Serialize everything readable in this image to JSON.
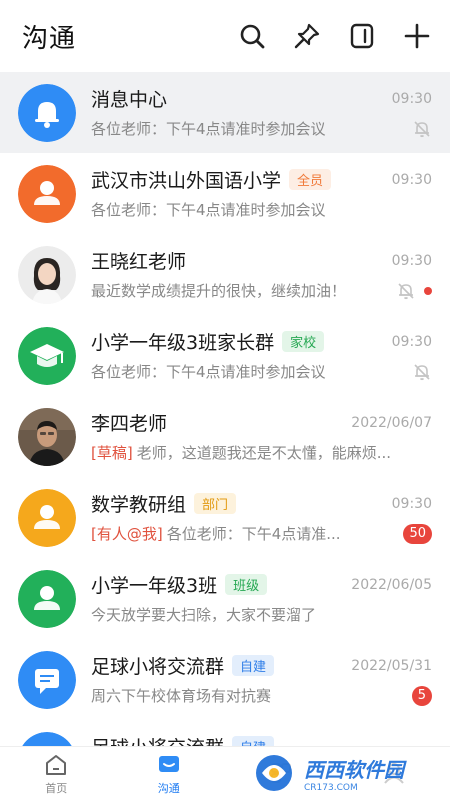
{
  "header": {
    "title": "沟通",
    "icons": [
      "search-icon",
      "pin-icon",
      "notebook-icon",
      "plus-icon"
    ]
  },
  "conversations": [
    {
      "name": "消息中心",
      "tag": "",
      "time": "09:30",
      "prefix": "",
      "preview": "各位老师：下午4点请准时参加会议",
      "muted": true,
      "dot": false,
      "badge": "",
      "avatar": "bell-icon",
      "avatar_color": "#2f8cf5"
    },
    {
      "name": "武汉市洪山外国语小学",
      "tag": "全员",
      "tag_color": "#f07a3a",
      "tag_bg": "#fdeee4",
      "time": "09:30",
      "prefix": "",
      "preview": "各位老师：下午4点请准时参加会议",
      "muted": false,
      "dot": false,
      "badge": "",
      "avatar": "group-icon",
      "avatar_color": "#f26b2c"
    },
    {
      "name": "王晓红老师",
      "tag": "",
      "time": "09:30",
      "prefix": "",
      "preview": "最近数学成绩提升的很快，继续加油！",
      "muted": true,
      "dot": true,
      "badge": "",
      "avatar": "photo-woman",
      "avatar_color": "#eeeeee"
    },
    {
      "name": "小学一年级3班家长群",
      "tag": "家校",
      "tag_color": "#27a853",
      "tag_bg": "#e3f5e8",
      "time": "09:30",
      "prefix": "",
      "preview": "各位老师：下午4点请准时参加会议",
      "muted": true,
      "dot": false,
      "badge": "",
      "avatar": "graduation-cap-icon",
      "avatar_color": "#22b05a"
    },
    {
      "name": "李四老师",
      "tag": "",
      "time": "2022/06/07",
      "prefix": "[草稿]",
      "preview": "老师，这道题我还是不太懂，能麻烦...",
      "muted": false,
      "dot": false,
      "badge": "",
      "avatar": "photo-man",
      "avatar_color": "#5a4a3a"
    },
    {
      "name": "数学教研组",
      "tag": "部门",
      "tag_color": "#e29a10",
      "tag_bg": "#fdf2dc",
      "time": "09:30",
      "prefix": "[有人@我]",
      "preview": "各位老师：下午4点请准...",
      "muted": false,
      "dot": false,
      "badge": "50",
      "avatar": "person-icon",
      "avatar_color": "#f5a81c"
    },
    {
      "name": "小学一年级3班",
      "tag": "班级",
      "tag_color": "#27a853",
      "tag_bg": "#e3f5e8",
      "time": "2022/06/05",
      "prefix": "",
      "preview": "今天放学要大扫除，大家不要溜了",
      "muted": false,
      "dot": false,
      "badge": "",
      "avatar": "person-icon",
      "avatar_color": "#22b05a"
    },
    {
      "name": "足球小将交流群",
      "tag": "自建",
      "tag_color": "#2f7ee8",
      "tag_bg": "#e3eefc",
      "time": "2022/05/31",
      "prefix": "",
      "preview": "周六下午校体育场有对抗赛",
      "muted": false,
      "dot": false,
      "badge": "5",
      "avatar": "chat-icon",
      "avatar_color": "#2f8cf5"
    },
    {
      "name": "足球小将交流群",
      "tag": "自建",
      "tag_color": "#2f7ee8",
      "tag_bg": "#e3eefc",
      "time": "",
      "prefix": "",
      "preview": "",
      "muted": false,
      "dot": false,
      "badge": "",
      "avatar": "chat-icon",
      "avatar_color": "#2f8cf5"
    }
  ],
  "tabs": [
    {
      "label": "首页",
      "icon": "home-icon",
      "active": false
    },
    {
      "label": "沟通",
      "icon": "message-icon",
      "active": true
    },
    {
      "label": "",
      "icon": "apps-icon",
      "active": false
    },
    {
      "label": "",
      "icon": "profile-icon",
      "active": false
    }
  ],
  "watermark": {
    "text": "西西软件园",
    "sub": "CR173.COM"
  }
}
